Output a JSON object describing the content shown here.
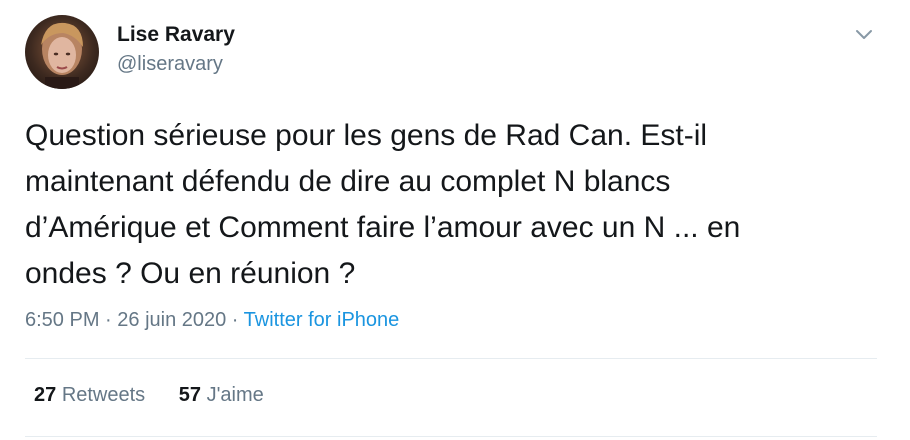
{
  "author": {
    "name": "Lise Ravary",
    "handle": "@liseravary",
    "avatar_icon": "profile-photo"
  },
  "tweet": {
    "lines": [
      "Question sérieuse pour les gens de Rad Can. Est-il",
      "maintenant défendu de dire au complet N blancs",
      "d’Amérique et Comment faire l’amour avec un N ... en",
      "ondes ? Ou en réunion ?"
    ]
  },
  "meta": {
    "time": "6:50 PM",
    "separator1": " · ",
    "date": "26 juin 2020",
    "separator2": " · ",
    "source": "Twitter for iPhone"
  },
  "stats": {
    "retweets_count": "27",
    "retweets_label": "Retweets",
    "likes_count": "57",
    "likes_label": "J'aime"
  },
  "colors": {
    "text": "#14171a",
    "secondary": "#657786",
    "link": "#1b95e0",
    "divider": "#e6ecf0"
  },
  "icons": {
    "more": "chevron-down-icon"
  }
}
